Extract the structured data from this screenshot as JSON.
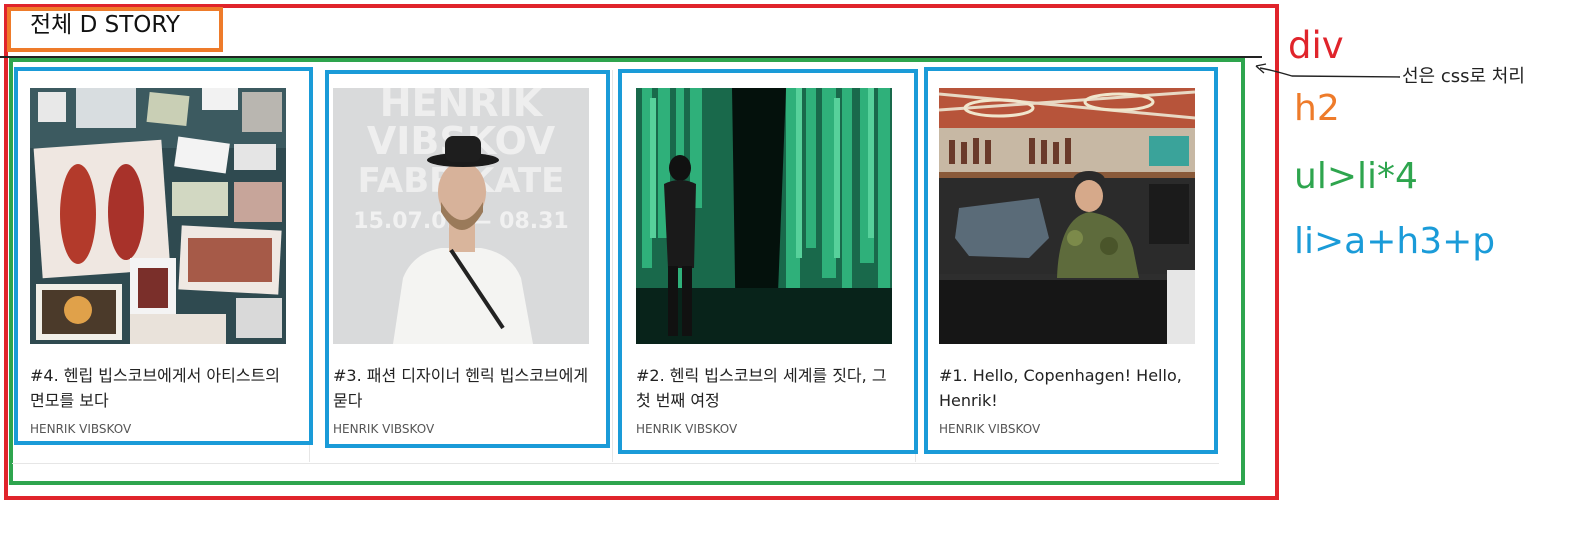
{
  "section": {
    "title": "전체 D STORY"
  },
  "cards": [
    {
      "title": "#4. 헨립 빕스코브에게서 아티스트의 면모를 보다",
      "author": "HENRIK VIBSKOV"
    },
    {
      "title": "#3. 패션 디자이너 헨릭 빕스코브에게 묻다",
      "author": "HENRIK VIBSKOV"
    },
    {
      "title": "#2. 헨릭 빕스코브의 세계를 짓다, 그 첫 번째 여정",
      "author": "HENRIK VIBSKOV"
    },
    {
      "title": "#1. Hello, Copenhagen! Hello, Henrik!",
      "author": "HENRIK VIBSKOV"
    }
  ],
  "poster": {
    "line1": "HENRIK",
    "line2": "VIBSKOV",
    "line3": "FABRIKATE",
    "line4": "15.07.09 — 08.31"
  },
  "annotations": {
    "div": "div",
    "h2": "h2",
    "ul": "ul>li*4",
    "li": "li>a+h3+p",
    "line_note": "선은 css로 처리"
  },
  "colors": {
    "div": "#e0242b",
    "h2": "#ee7b2a",
    "ul": "#2ea54e",
    "li": "#1a9bd8"
  }
}
